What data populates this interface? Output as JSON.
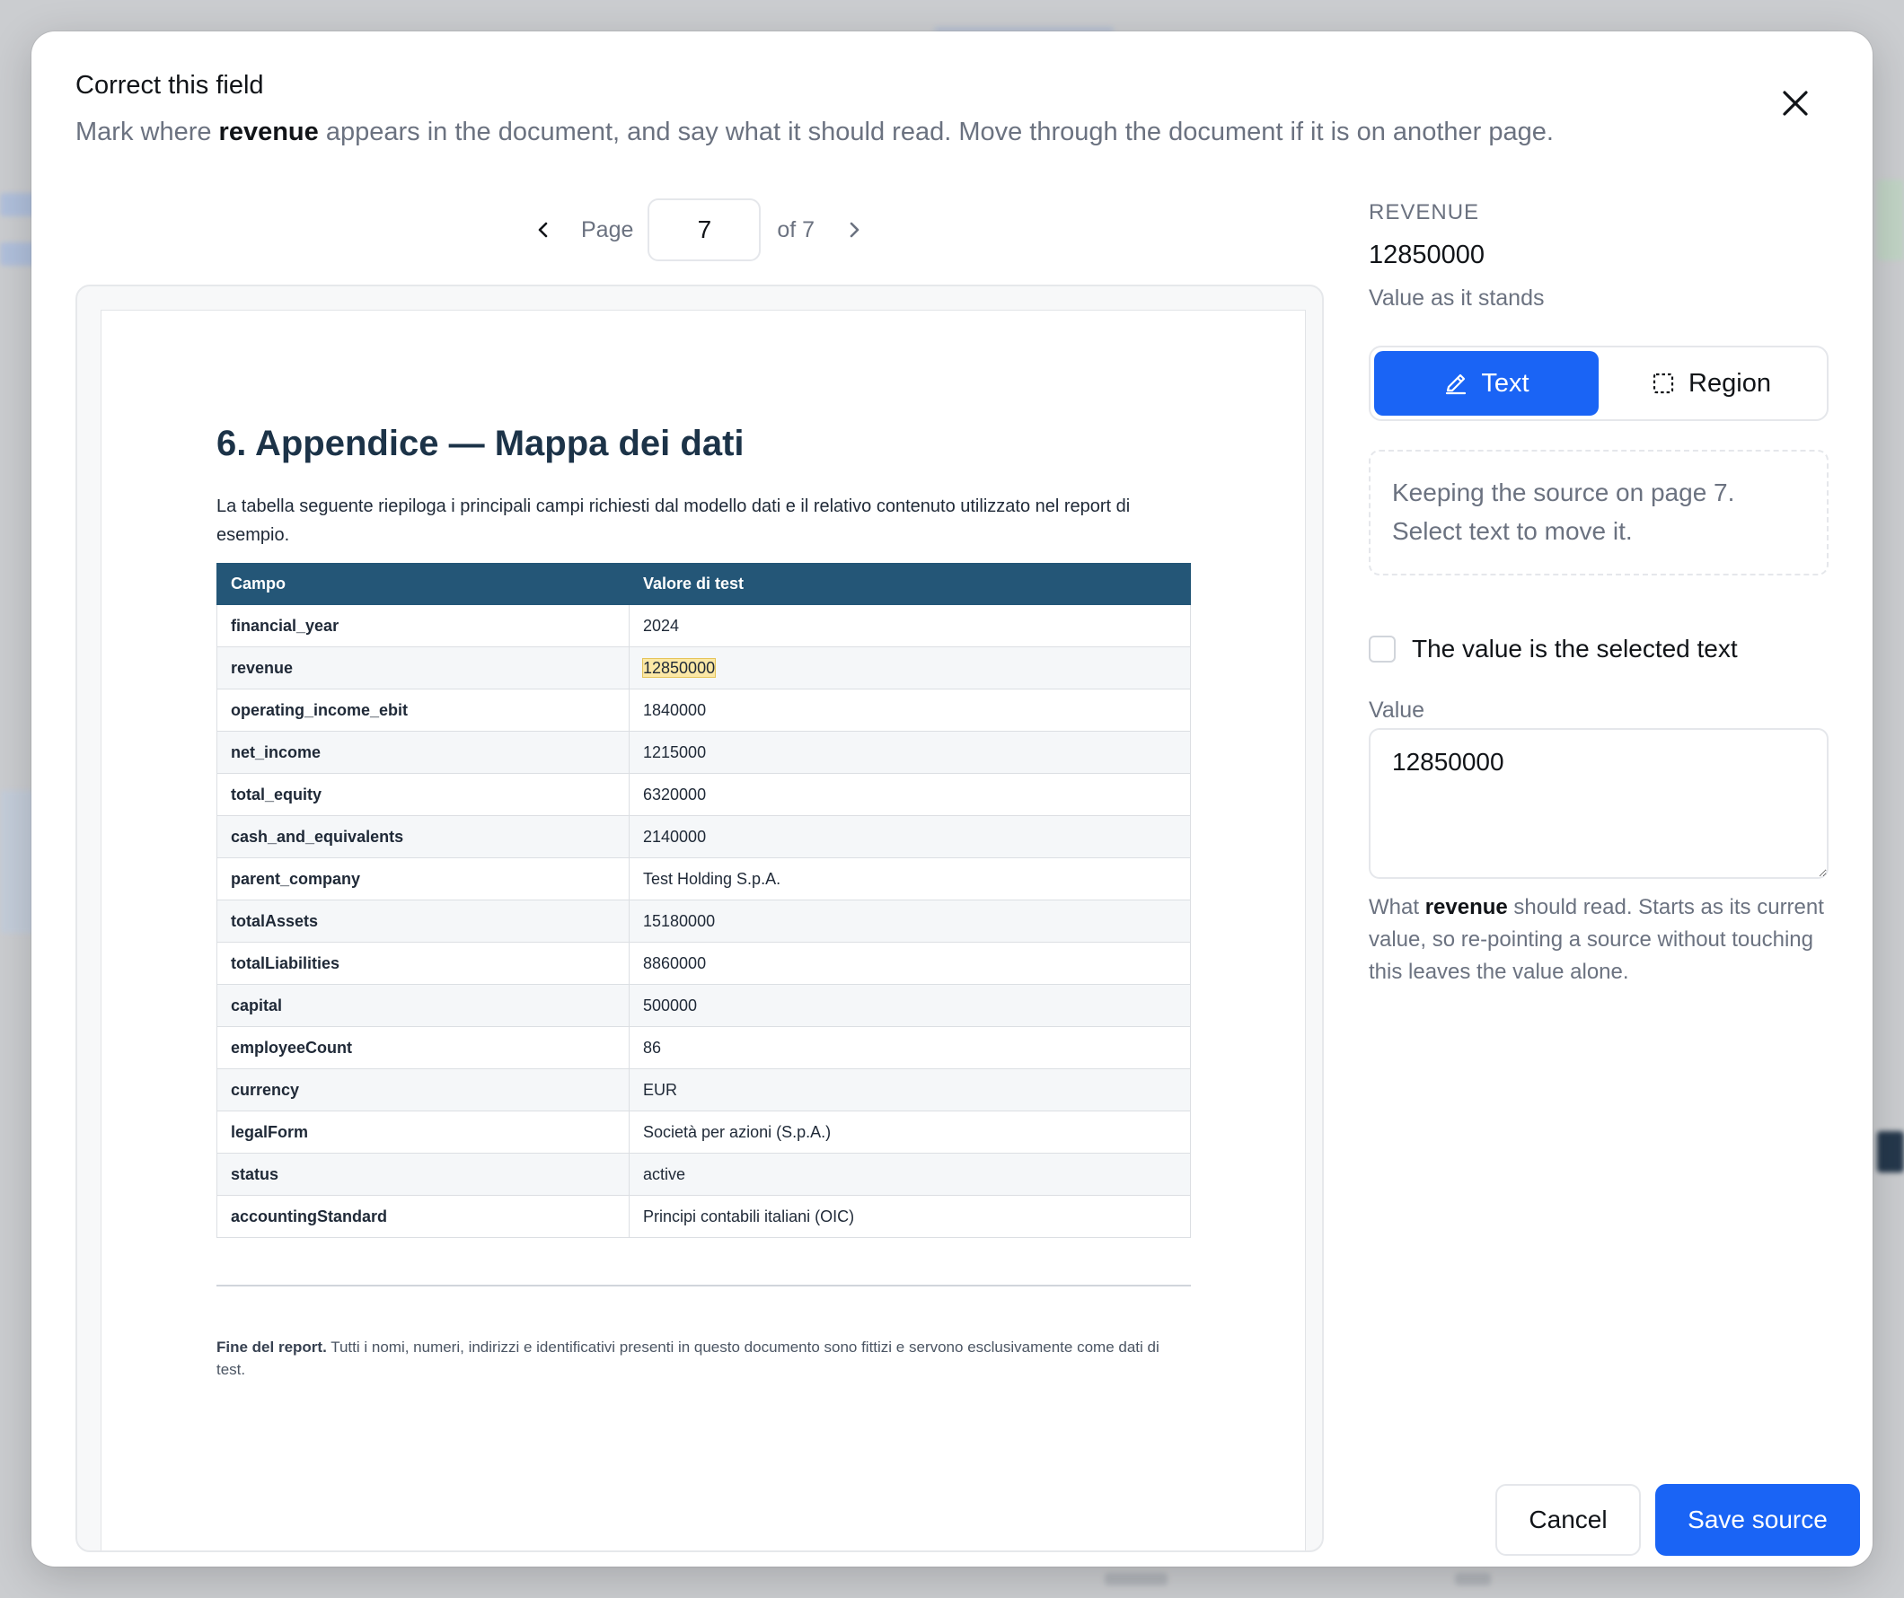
{
  "modal": {
    "title": "Correct this field",
    "subtitle_pre": "Mark where ",
    "subtitle_field": "revenue",
    "subtitle_post": " appears in the document, and say what it should read. Move through the document if it is on another page.",
    "close_icon": "close-icon"
  },
  "pager": {
    "prev_icon": "chevron-left-icon",
    "page_label": "Page",
    "current_page": "7",
    "of_label": "of 7",
    "next_icon": "chevron-right-icon"
  },
  "document": {
    "heading": "6. Appendice — Mappa dei dati",
    "intro": "La tabella seguente riepiloga i principali campi richiesti dal modello dati e il relativo contenuto utilizzato nel report di esempio.",
    "table_headers": [
      "Campo",
      "Valore di test"
    ],
    "rows": [
      {
        "key": "financial_year",
        "value": "2024"
      },
      {
        "key": "revenue",
        "value": "12850000"
      },
      {
        "key": "operating_income_ebit",
        "value": "1840000"
      },
      {
        "key": "net_income",
        "value": "1215000"
      },
      {
        "key": "total_equity",
        "value": "6320000"
      },
      {
        "key": "cash_and_equivalents",
        "value": "2140000"
      },
      {
        "key": "parent_company",
        "value": "Test Holding S.p.A."
      },
      {
        "key": "totalAssets",
        "value": "15180000"
      },
      {
        "key": "totalLiabilities",
        "value": "8860000"
      },
      {
        "key": "capital",
        "value": "500000"
      },
      {
        "key": "employeeCount",
        "value": "86"
      },
      {
        "key": "currency",
        "value": "EUR"
      },
      {
        "key": "legalForm",
        "value": "Società per azioni (S.p.A.)"
      },
      {
        "key": "status",
        "value": "active"
      },
      {
        "key": "accountingStandard",
        "value": "Principi contabili italiani (OIC)"
      }
    ],
    "highlighted_row": 1,
    "footer_bold": "Fine del report.",
    "footer_text": " Tutti i nomi, numeri, indirizzi e identificativi presenti in questo documento sono fittizi e servono esclusivamente come dati di test."
  },
  "panel": {
    "field_label": "REVENUE",
    "field_value": "12850000",
    "field_caption": "Value as it stands",
    "mode_text_label": "Text",
    "mode_text_icon": "highlighter-icon",
    "mode_region_label": "Region",
    "mode_region_icon": "dashed-square-icon",
    "info": "Keeping the source on page 7. Select text to move it.",
    "checkbox_label": "The value is the selected text",
    "checkbox_checked": false,
    "value_label": "Value",
    "value": "12850000",
    "hint_pre": "What ",
    "hint_field": "revenue",
    "hint_post": " should read. Starts as its current value, so re-pointing a source without touching this leaves the value alone."
  },
  "actions": {
    "cancel_label": "Cancel",
    "save_label": "Save source"
  },
  "colors": {
    "accent": "#1a64f5",
    "table_header": "#245677",
    "highlight": "#fbe8a6"
  }
}
